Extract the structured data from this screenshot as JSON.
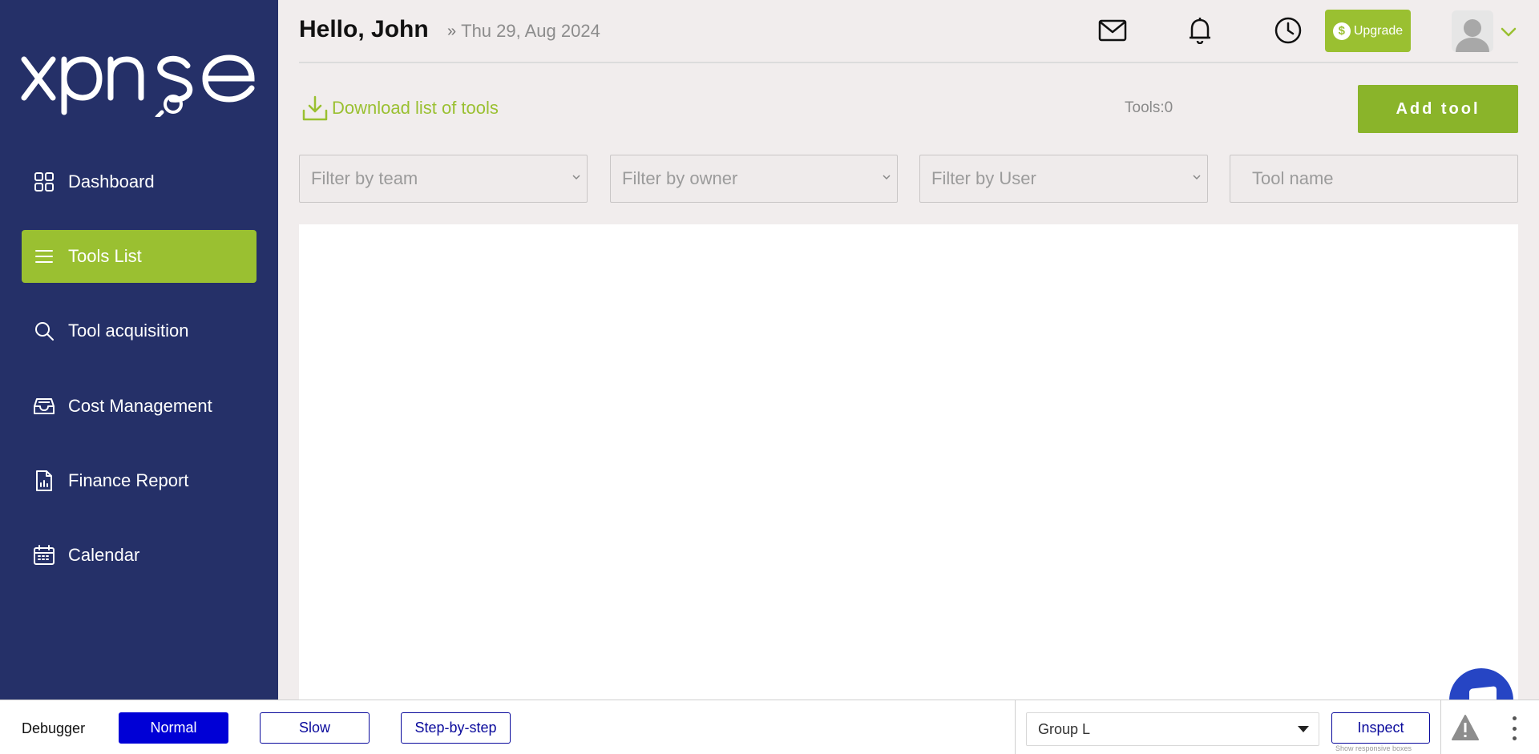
{
  "brand": {
    "logo_text": "xpnse"
  },
  "sidebar": {
    "items": [
      {
        "label": "Dashboard",
        "icon": "grid-icon",
        "active": false
      },
      {
        "label": "Tools List",
        "icon": "list-icon",
        "active": true
      },
      {
        "label": "Tool acquisition",
        "icon": "search-icon",
        "active": false
      },
      {
        "label": "Cost Management",
        "icon": "inbox-icon",
        "active": false
      },
      {
        "label": "Finance Report",
        "icon": "report-icon",
        "active": false
      },
      {
        "label": "Calendar",
        "icon": "calendar-icon",
        "active": false
      }
    ]
  },
  "header": {
    "greeting": "Hello, John",
    "date": "Thu 29, Aug 2024",
    "upgrade_label": "Upgrade",
    "icons": [
      "mail-icon",
      "bell-icon",
      "clock-icon"
    ]
  },
  "toolbar": {
    "download_label": "Download list of tools",
    "tools_count": "Tools:0",
    "add_tool_label": "Add tool"
  },
  "filters": {
    "team_placeholder": "Filter by team",
    "owner_placeholder": "Filter by owner",
    "user_placeholder": "Filter by User",
    "tool_name_placeholder": "Tool name"
  },
  "debugger": {
    "label": "Debugger",
    "modes": [
      "Normal",
      "Slow",
      "Step-by-step"
    ],
    "selected_mode": "Normal",
    "group_value": "Group L",
    "inspect_label": "Inspect",
    "responsive_note": "Show responsive boxes"
  },
  "colors": {
    "sidebar_bg": "#253068",
    "accent": "#9ac031",
    "debugger_accent": "#0000d6"
  }
}
